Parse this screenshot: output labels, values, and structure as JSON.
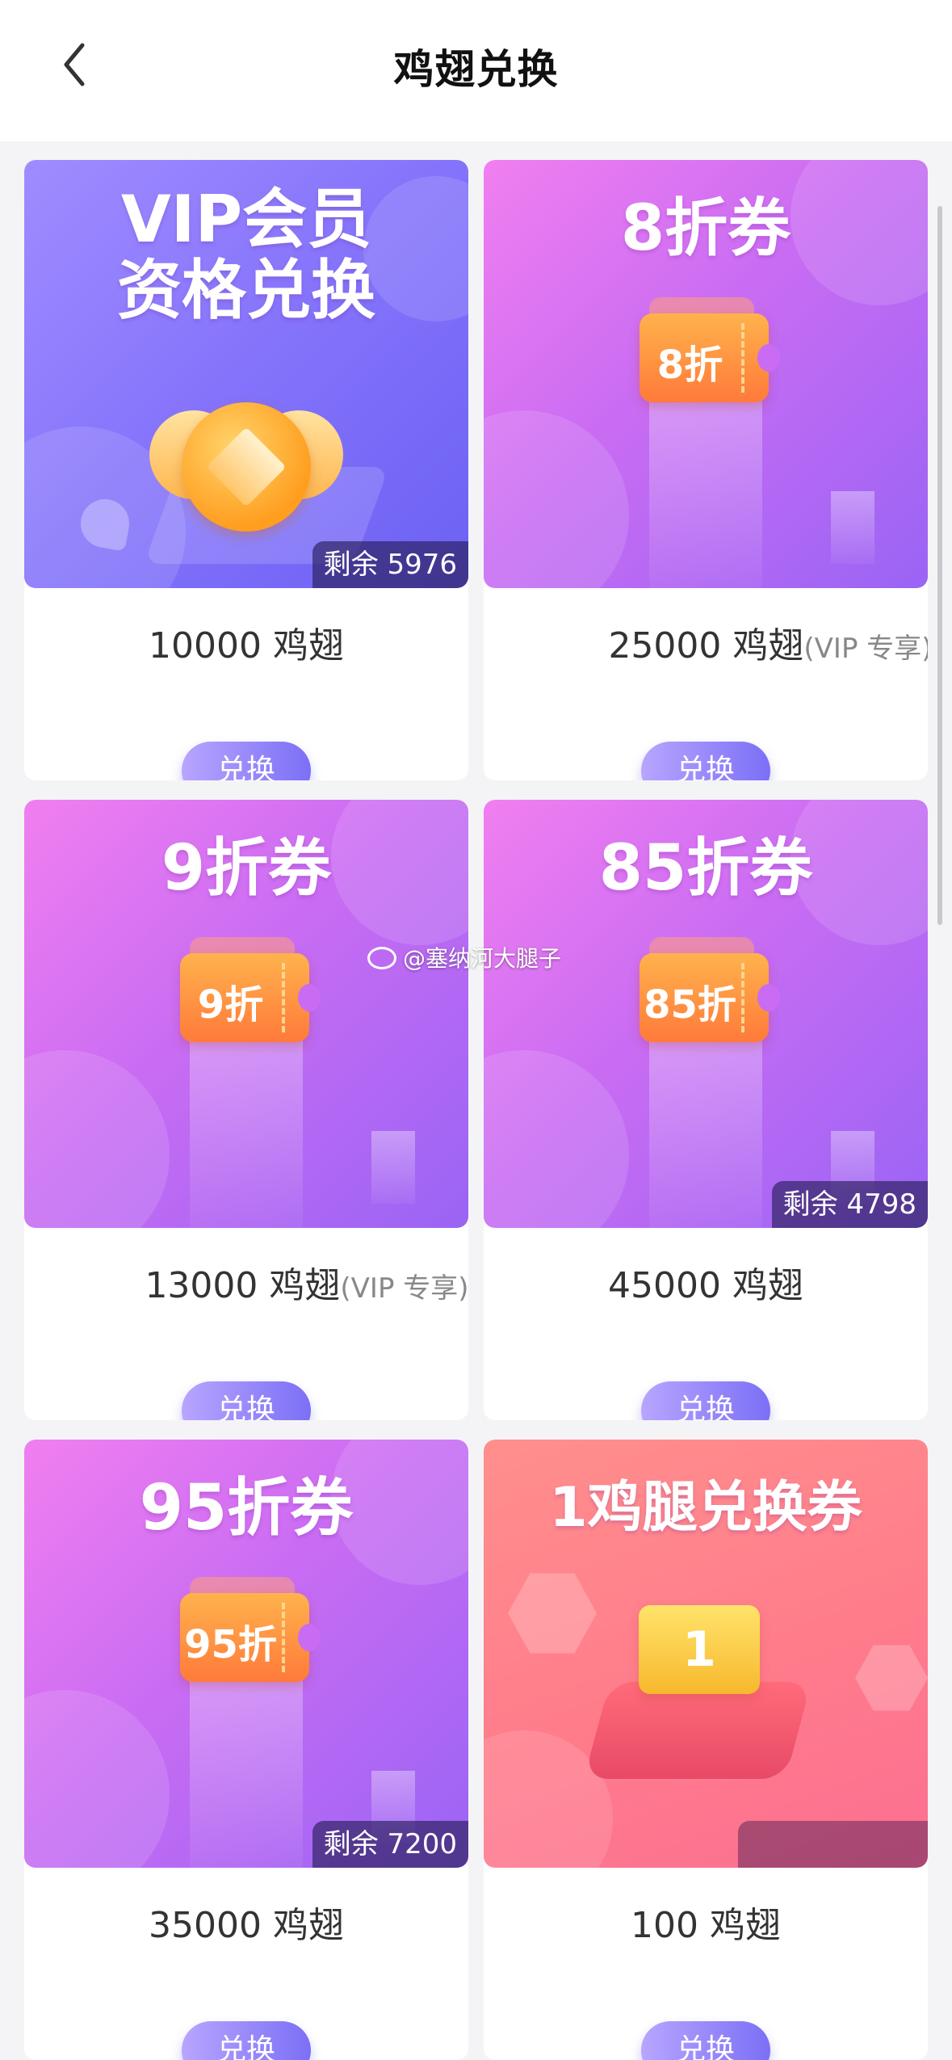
{
  "header": {
    "title": "鸡翅兑换"
  },
  "watermark": "@塞纳河大腿子",
  "cards": [
    {
      "art_title_line1": "VIP会员",
      "art_title_line2": "资格兑换",
      "remain": "剩余 5976",
      "price": "10000 鸡翅",
      "vip_note": "",
      "button": "兑换"
    },
    {
      "art_title": "8折券",
      "ticket": "8折",
      "remain": "",
      "price": "25000 鸡翅",
      "vip_note": "(VIP 专享)",
      "button": "兑换"
    },
    {
      "art_title": "9折券",
      "ticket": "9折",
      "remain": "",
      "price": "13000 鸡翅",
      "vip_note": "(VIP 专享)",
      "button": "兑换"
    },
    {
      "art_title": "85折券",
      "ticket": "85折",
      "remain": "剩余 4798",
      "price": "45000 鸡翅",
      "vip_note": "",
      "button": "兑换"
    },
    {
      "art_title": "95折券",
      "ticket": "95折",
      "remain": "剩余 7200",
      "price": "35000 鸡翅",
      "vip_note": "",
      "button": "兑换"
    },
    {
      "art_title": "1鸡腿兑换券",
      "ticket": "1",
      "remain": "",
      "price": "100 鸡翅",
      "vip_note": "",
      "button": "兑换"
    }
  ],
  "colors": {
    "accent": "#7b70f6",
    "title_text": "#111111",
    "price_text": "#333333"
  }
}
